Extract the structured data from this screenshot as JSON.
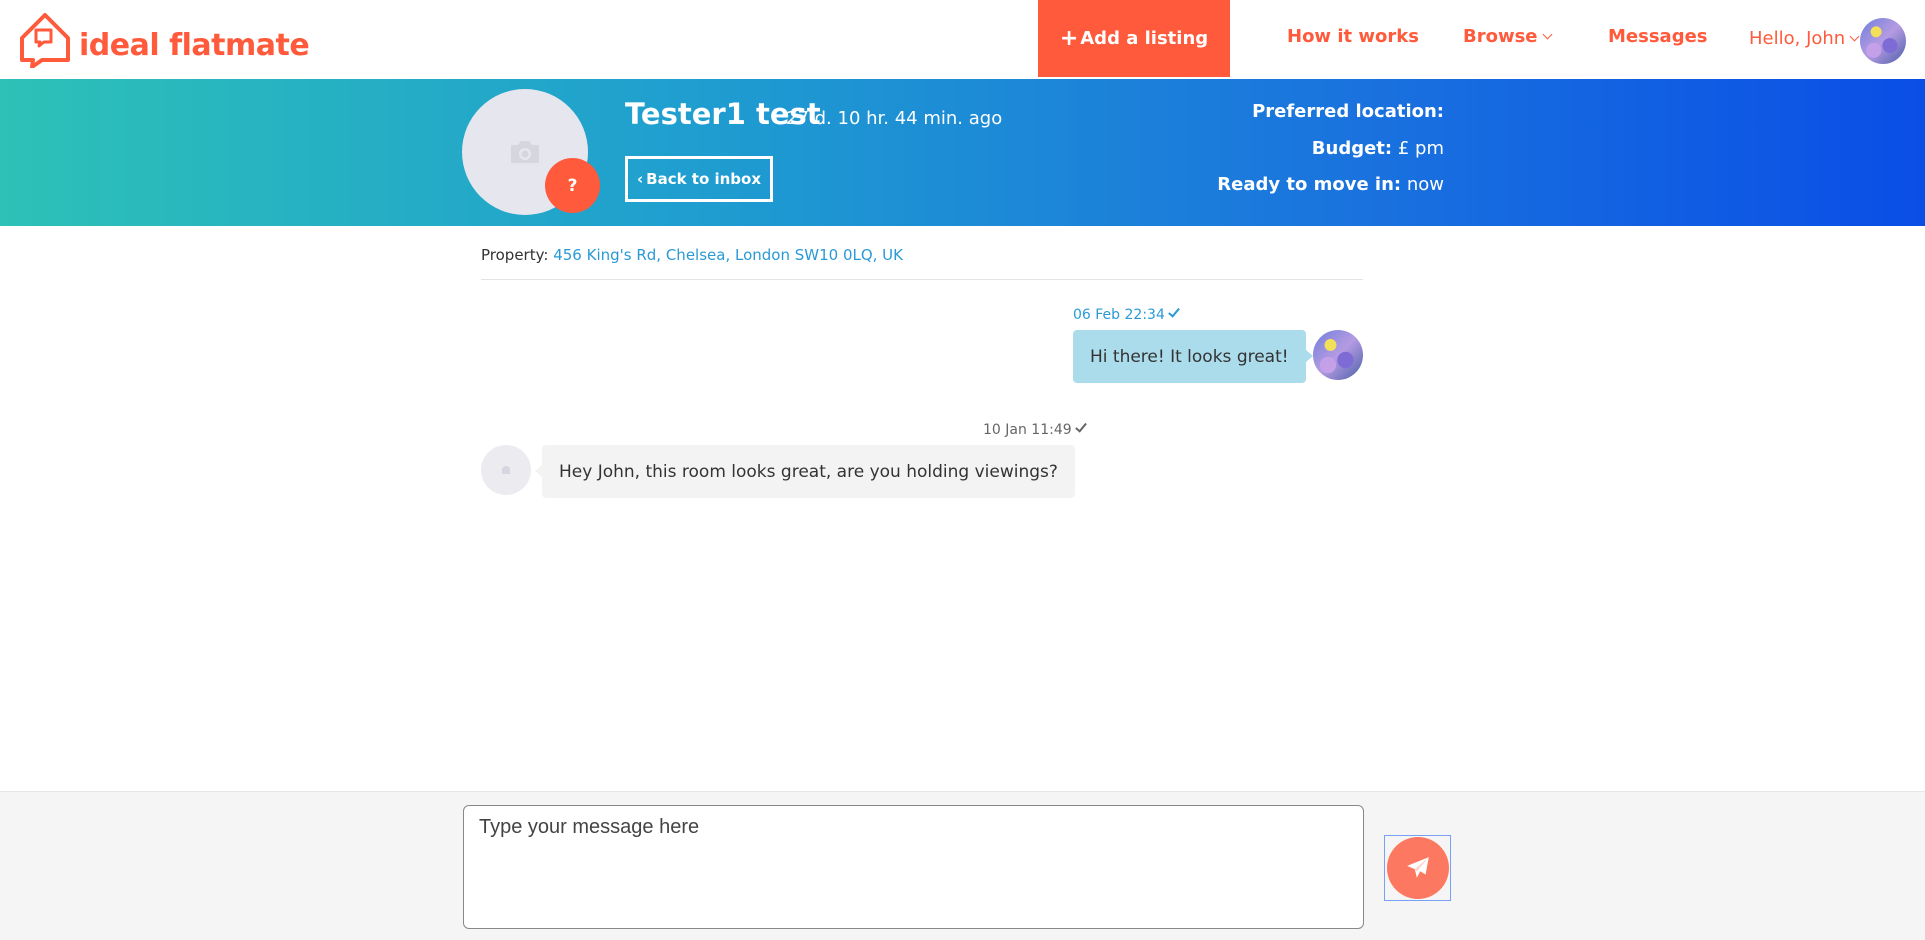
{
  "brand": {
    "name": "ideal flatmate",
    "color": "#ff5a3c"
  },
  "nav": {
    "add_listing": "Add a listing",
    "how_it_works": "How it works",
    "browse": "Browse",
    "messages": "Messages",
    "greeting": "Hello, John"
  },
  "header": {
    "name": "Tester1 test",
    "last_active": "27 d. 10 hr. 44 min. ago",
    "back_button": "Back to inbox",
    "badge": "?",
    "preferred_location_label": "Preferred location:",
    "preferred_location_value": "",
    "budget_label": "Budget:",
    "budget_value": "£ pm",
    "move_in_label": "Ready to move in:",
    "move_in_value": "now"
  },
  "property": {
    "label": "Property:",
    "address": "456 King's Rd, Chelsea, London SW10 0LQ, UK"
  },
  "messages": [
    {
      "direction": "sent",
      "time": "06 Feb 22:34",
      "text": "Hi there! It looks great!"
    },
    {
      "direction": "received",
      "time": "10 Jan 11:49",
      "text": "Hey John, this room looks great, are you holding viewings?"
    }
  ],
  "composer": {
    "placeholder": "Type your message here",
    "value": ""
  },
  "icons": {
    "logo": "house-speech-bubble-icon",
    "add": "plus-icon",
    "dropdown": "chevron-down-icon",
    "camera": "camera-icon",
    "read": "check-icon",
    "send": "paper-plane-icon"
  }
}
